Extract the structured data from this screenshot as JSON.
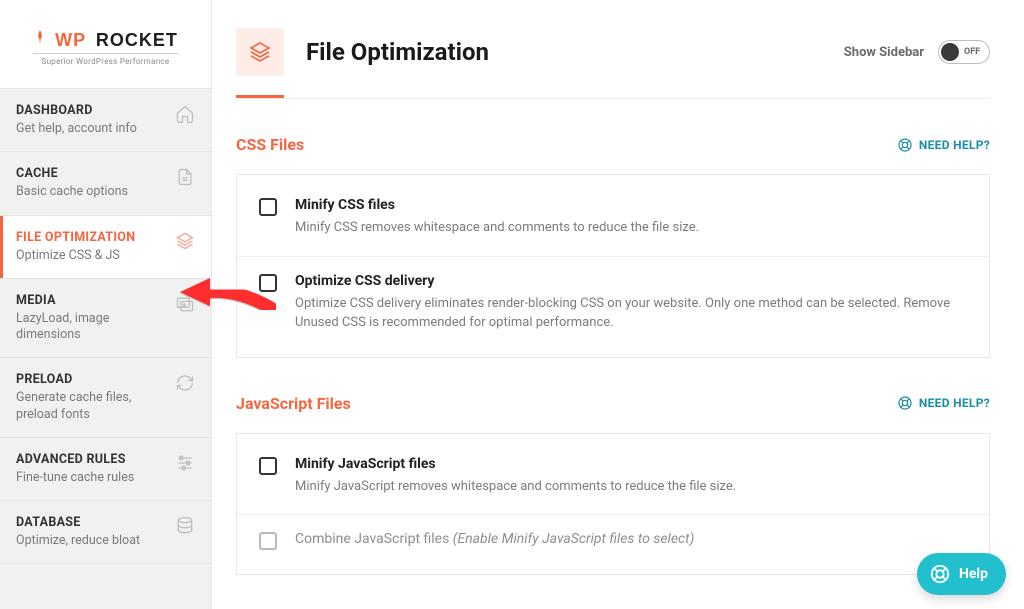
{
  "logo": {
    "prefix": "WP",
    "suffix": "ROCKET",
    "tagline": "Superior WordPress Performance"
  },
  "nav": [
    {
      "title": "DASHBOARD",
      "desc": "Get help, account info",
      "icon": "home"
    },
    {
      "title": "CACHE",
      "desc": "Basic cache options",
      "icon": "file"
    },
    {
      "title": "FILE OPTIMIZATION",
      "desc": "Optimize CSS & JS",
      "icon": "layers",
      "active": true
    },
    {
      "title": "MEDIA",
      "desc": "LazyLoad, image dimensions",
      "icon": "media"
    },
    {
      "title": "PRELOAD",
      "desc": "Generate cache files, preload fonts",
      "icon": "refresh"
    },
    {
      "title": "ADVANCED RULES",
      "desc": "Fine-tune cache rules",
      "icon": "sliders"
    },
    {
      "title": "DATABASE",
      "desc": "Optimize, reduce bloat",
      "icon": "database"
    }
  ],
  "header": {
    "title": "File Optimization",
    "show_sidebar": "Show Sidebar",
    "toggle_state": "OFF"
  },
  "help_label": "NEED HELP?",
  "sections": [
    {
      "title": "CSS Files",
      "options": [
        {
          "title": "Minify CSS files",
          "desc": "Minify CSS removes whitespace and comments to reduce the file size."
        },
        {
          "title": "Optimize CSS delivery",
          "desc": "Optimize CSS delivery eliminates render-blocking CSS on your website. Only one method can be selected. Remove Unused CSS is recommended for optimal performance."
        }
      ]
    },
    {
      "title": "JavaScript Files",
      "options": [
        {
          "title": "Minify JavaScript files",
          "desc": "Minify JavaScript removes whitespace and comments to reduce the file size."
        },
        {
          "title": "Combine JavaScript files",
          "note": "(Enable Minify JavaScript files to select)",
          "desc": "",
          "disabled": true
        }
      ]
    }
  ],
  "fab": {
    "label": "Help"
  }
}
